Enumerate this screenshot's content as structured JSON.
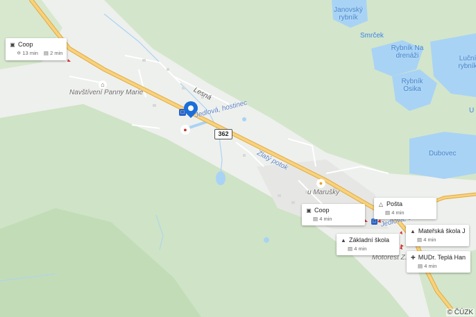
{
  "map": {
    "copyright": "© ČÚZK",
    "road_number": "362",
    "water_labels": [
      "Janovský rybník",
      "Smrček",
      "Rybník Na drenáži",
      "Luční rybník",
      "Rybník Osika",
      "Dubovec"
    ],
    "road_labels": [
      "Lesná",
      "Zlatý potok",
      "Jedlová, hostinec",
      "Jedlová, obú"
    ],
    "place_labels": [
      "Navštívení Panny Marie",
      "u Marušky",
      "Motorest Z..."
    ],
    "edge_label": "U",
    "colors": {
      "water": "#a9d3f5",
      "forest": "#c9dfc0",
      "road": "#f2c562",
      "marker": "#1a6fd8"
    }
  },
  "poi_cards": [
    {
      "title": "Coop",
      "icon": "cart-icon",
      "walk": "13 min",
      "drive": "2 min"
    },
    {
      "title": "Coop",
      "icon": "cart-icon",
      "drive": "4 min"
    },
    {
      "title": "Pošta",
      "icon": "post-icon",
      "drive": "4 min"
    },
    {
      "title": "Základní škola",
      "icon": "school-icon",
      "drive": "4 min"
    },
    {
      "title": "Mateřská škola Je...",
      "icon": "school-icon",
      "drive": "4 min"
    },
    {
      "title": "MUDr. Teplá Han...",
      "icon": "medical-icon",
      "drive": "4 min"
    }
  ]
}
